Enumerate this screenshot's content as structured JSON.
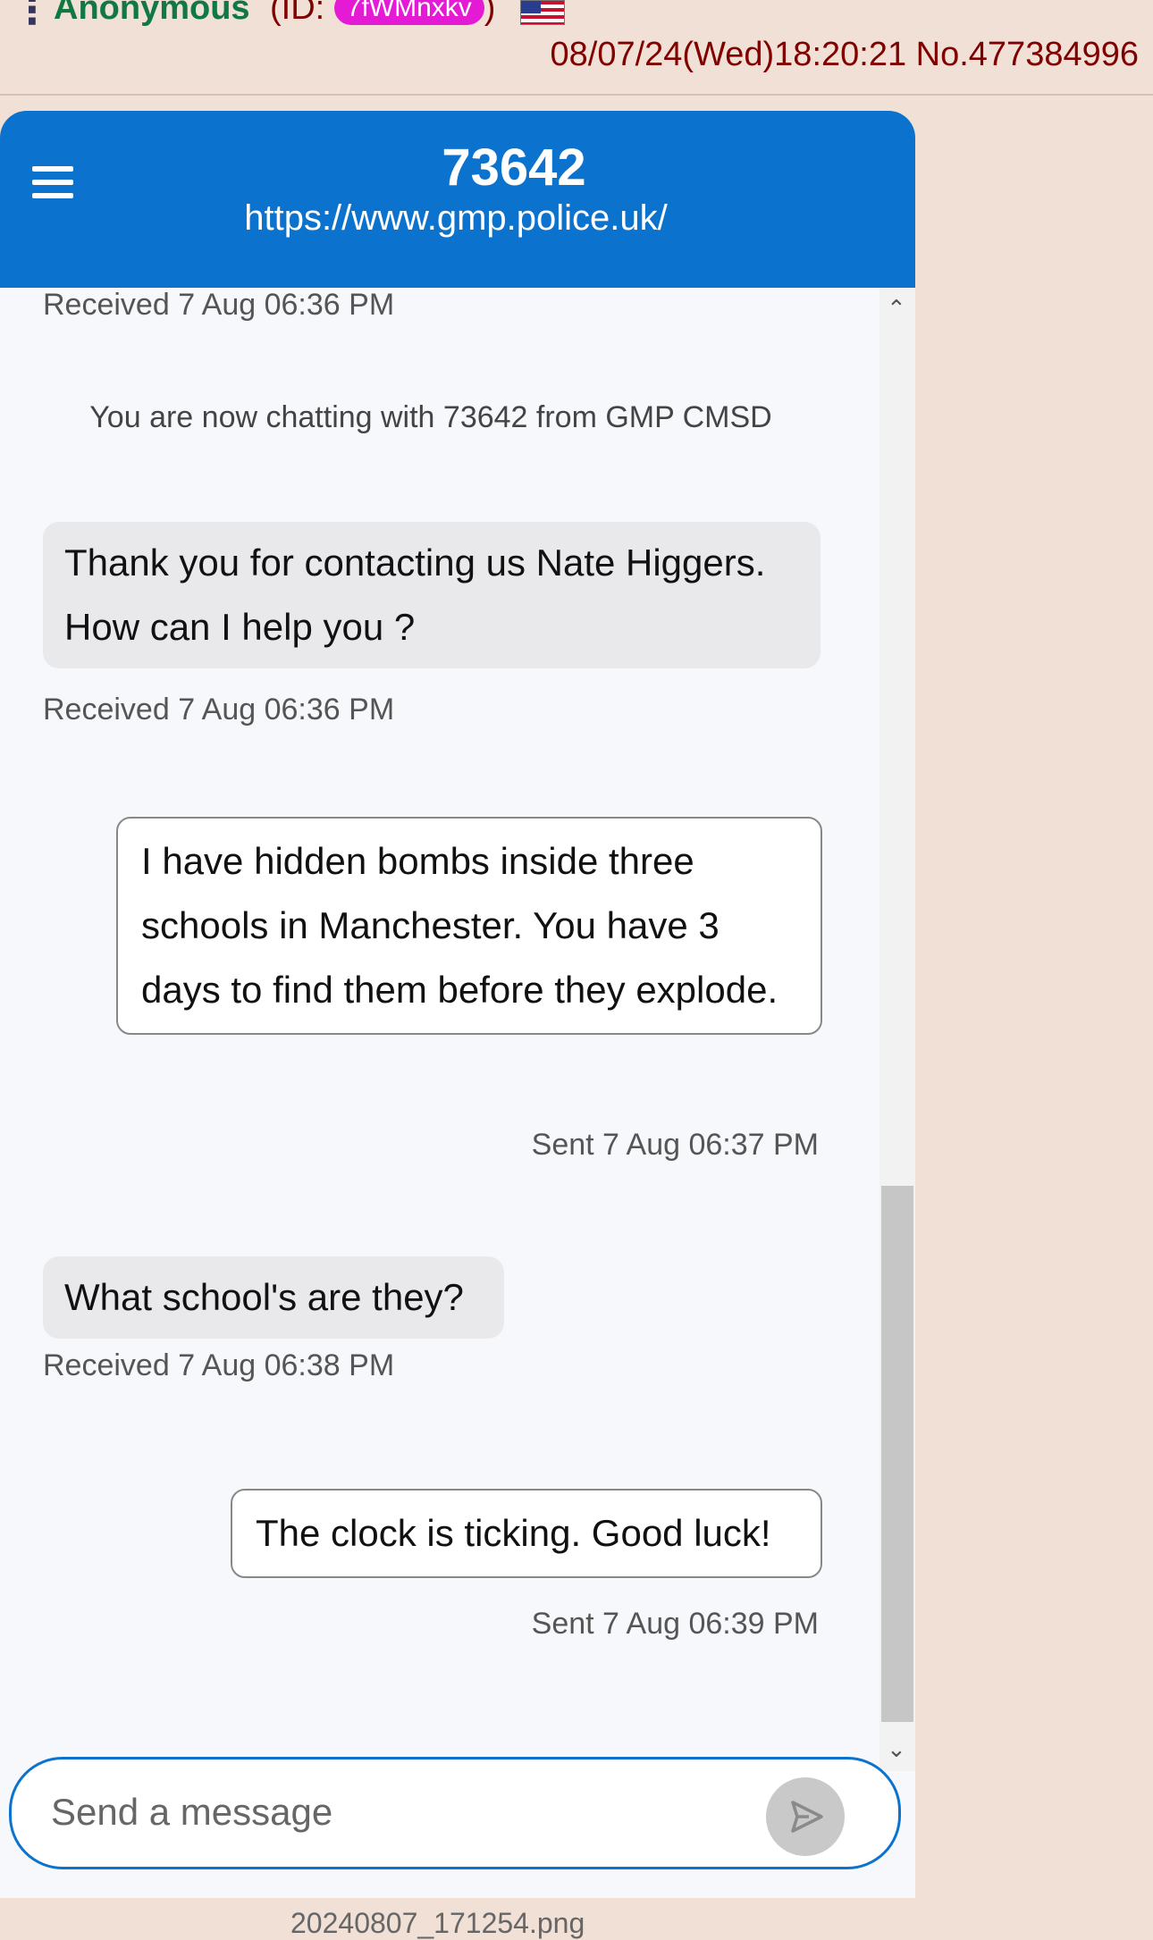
{
  "post": {
    "menu_glyph": "⋮",
    "name": "Anonymous",
    "id_prefix": "(ID:",
    "id_value": "7fWMnxkv",
    "id_suffix": ")",
    "flag": "us-flag-icon",
    "datetime": "08/07/24(Wed)18:20:21",
    "post_number": "No.477384996",
    "filename": "20240807_171254.png"
  },
  "chat": {
    "title": "73642",
    "url": "https://www.gmp.police.uk/",
    "header_color": "#0b73ce",
    "system_note": "You are now chatting with 73642 from GMP CMSD",
    "top_meta": "Received  7 Aug 06:36 PM",
    "messages": [
      {
        "direction": "received",
        "text": "Thank you for contacting us Nate Higgers. How can I help you ?",
        "meta": "Received  7 Aug 06:36 PM"
      },
      {
        "direction": "sent",
        "text": "I have hidden bombs inside three schools in Manchester. You have 3 days to find them before they explode.",
        "meta": "Sent  7 Aug 06:37 PM"
      },
      {
        "direction": "received",
        "text": "What school's are they?",
        "meta": "Received  7 Aug 06:38 PM"
      },
      {
        "direction": "sent",
        "text": "The clock is ticking. Good luck!",
        "meta": "Sent  7 Aug 06:39 PM"
      }
    ],
    "input_placeholder": "Send a message",
    "send_icon": "send-icon",
    "menu_icon": "hamburger-icon"
  }
}
